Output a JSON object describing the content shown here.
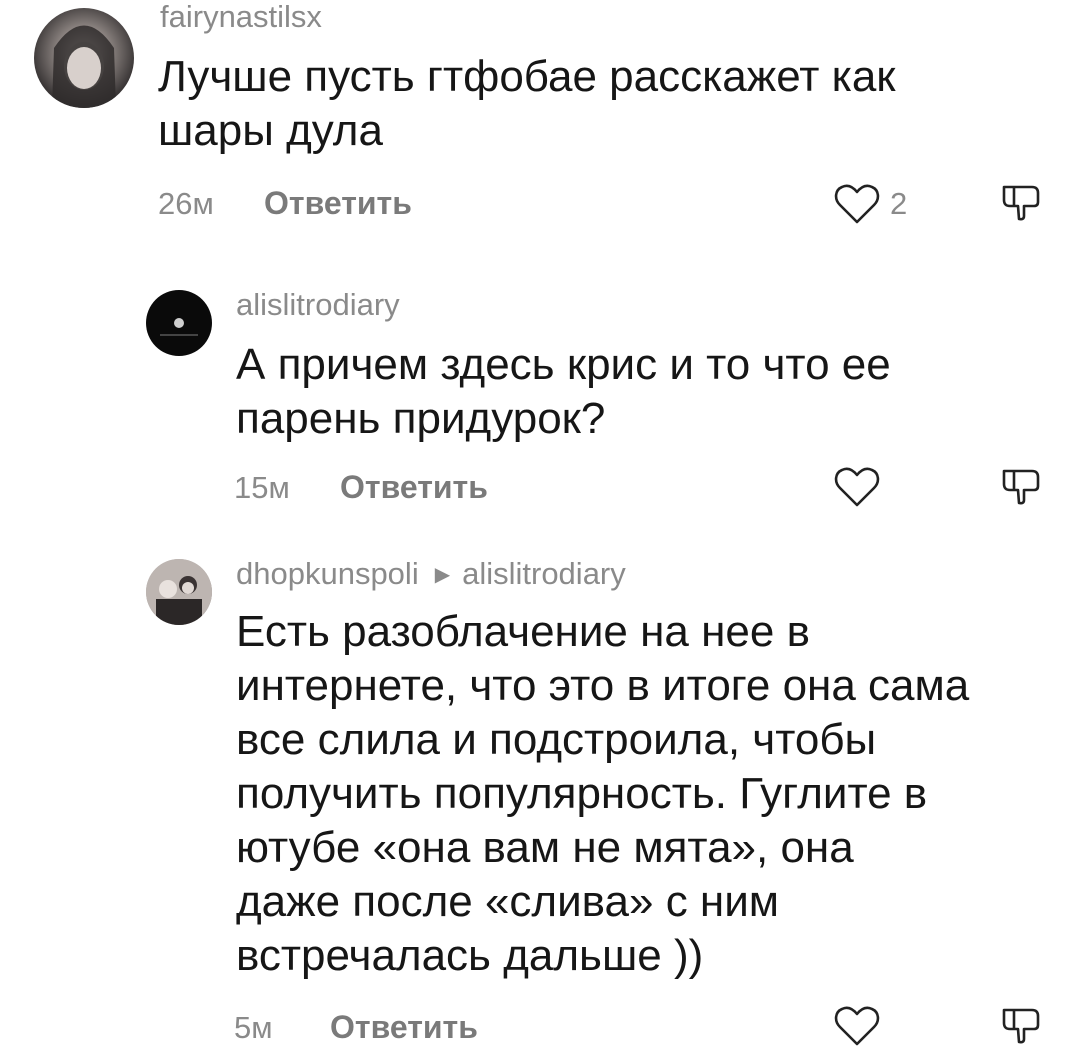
{
  "comments": [
    {
      "username": "fairynastilsx",
      "lines": [
        "Лучше пусть гтфобае расскажет как",
        "шары дула"
      ],
      "time": "26м",
      "reply_label": "Ответить",
      "like_count": "2",
      "avatar_icon": "profile-photo"
    },
    {
      "username": "alislitrodiary",
      "lines": [
        "А причем здесь крис и то что ее",
        "парень придурок?"
      ],
      "time": "15м",
      "reply_label": "Ответить",
      "like_count": "",
      "avatar_icon": "moon-dark-circle"
    },
    {
      "username": "dhopkunspoli",
      "reply_to": "alislitrodiary",
      "lines": [
        "Есть разоблачение на нее в",
        "интернете, что это в итоге она сама",
        "все слила и подстроила, чтобы",
        "получить популярность. Гуглите в",
        "ютубе «она вам не мята», она",
        "даже после «слива» с ним",
        "встречалась дальше ))"
      ],
      "time": "5м",
      "reply_label": "Ответить",
      "like_count": "",
      "avatar_icon": "group-photo"
    }
  ],
  "icons": {
    "like": "heart-outline-icon",
    "dislike": "thumbs-down-icon",
    "reply_arrow": "triangle-right-icon"
  },
  "colors": {
    "text": "#161616",
    "muted": "#8a8a8a",
    "background": "#ffffff"
  }
}
